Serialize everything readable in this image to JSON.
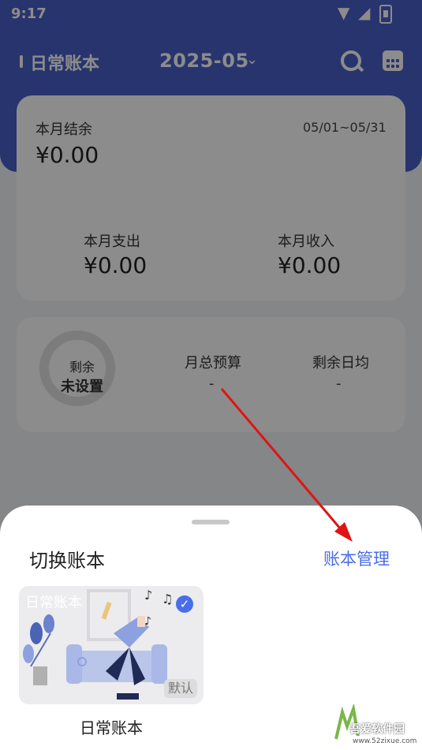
{
  "status": {
    "time": "9:17"
  },
  "header": {
    "book_title": "日常账本",
    "date": "2025-05"
  },
  "summary": {
    "balance_label": "本月结余",
    "balance_value": "¥0.00",
    "date_range": "05/01~05/31",
    "expense_label": "本月支出",
    "expense_value": "¥0.00",
    "income_label": "本月收入",
    "income_value": "¥0.00"
  },
  "budget": {
    "ring_label": "剩余",
    "ring_value": "未设置",
    "total_label": "月总预算",
    "total_value": "-",
    "daily_label": "剩余日均",
    "daily_value": "-"
  },
  "sheet": {
    "title": "切换账本",
    "manage": "账本管理",
    "books": [
      {
        "title": "日常账本",
        "badge": "默认",
        "name": "日常账本"
      }
    ]
  },
  "watermark": {
    "text": "吾爱软件园",
    "url": "www.52zixue.com"
  },
  "colors": {
    "accent": "#4a5fc8",
    "link": "#4a6ee8",
    "arrow": "#e01414"
  }
}
